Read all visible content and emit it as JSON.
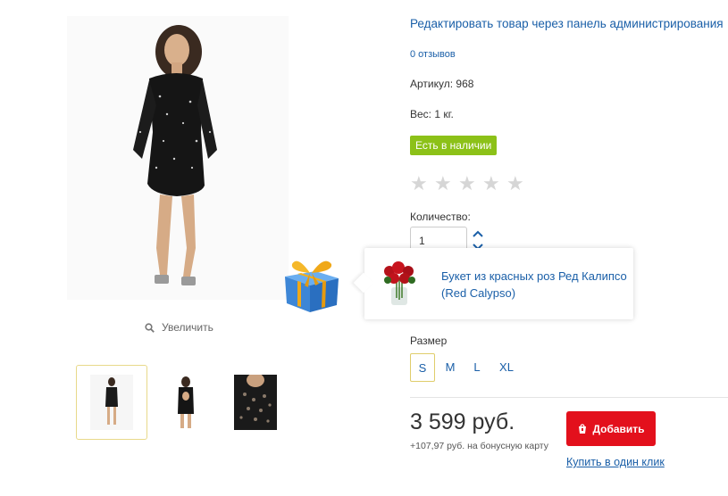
{
  "product": {
    "admin_edit_link": "Редактировать товар через панель администрирования",
    "reviews_link": "0 отзывов",
    "sku": "Артикул: 968",
    "weight": "Вес: 1 кг.",
    "stock_badge": "Есть в наличии",
    "rating": {
      "value": 0,
      "max": 5
    },
    "quantity_label": "Количество:",
    "quantity_value": "1",
    "size_label": "Размер",
    "sizes": [
      "S",
      "M",
      "L",
      "XL"
    ],
    "selected_size": "S",
    "price": "3 599 руб.",
    "bonus": "+107,97 руб. на бонусную карту",
    "add_button": "Добавить",
    "one_click": "Купить в один клик"
  },
  "gallery": {
    "zoom_label": "Увеличить",
    "thumbnails_count": 3,
    "active_thumbnail": 0
  },
  "gift": {
    "title": "Букет из красных роз Ред Калипсо (Red Calypso)"
  },
  "colors": {
    "link": "#1a5fa8",
    "stock_badge": "#8cc118",
    "add_button": "#e3101c",
    "selected_border": "#e0cd6b"
  }
}
